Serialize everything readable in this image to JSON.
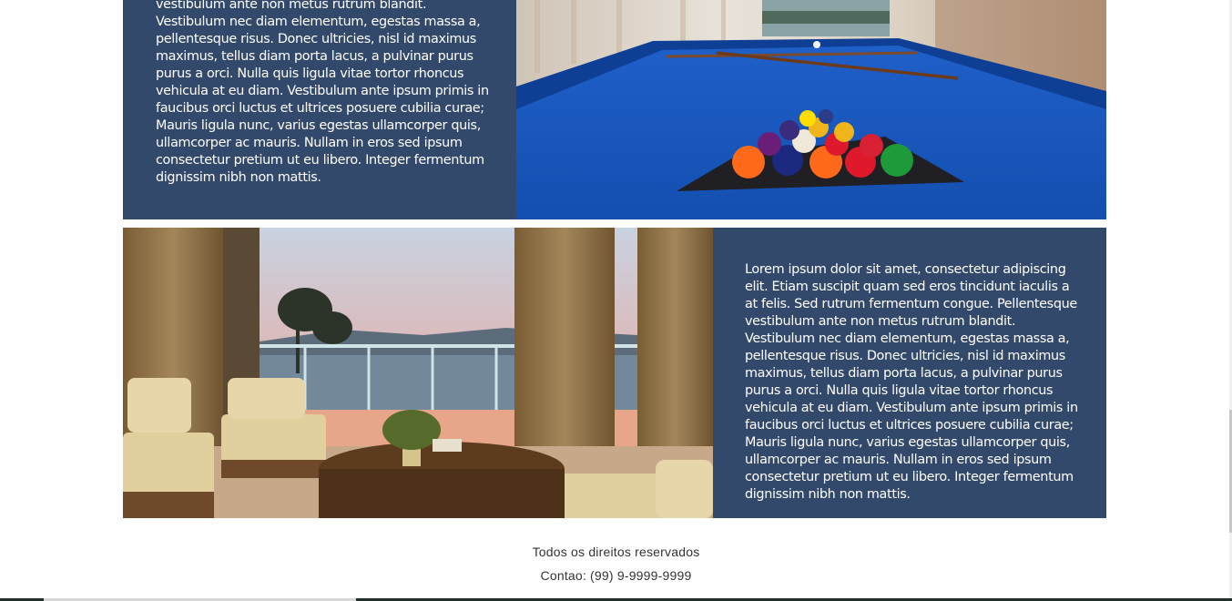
{
  "sections": [
    {
      "text": "Sed rutrum fermentum congue. Pellentesque vestibulum ante non metus rutrum blandit. Vestibulum nec diam elementum, egestas massa a, pellentesque risus. Donec ultricies, nisl id maximus maximus, tellus diam porta lacus, a pulvinar purus purus a orci. Nulla quis ligula vitae tortor rhoncus vehicula at eu diam. Vestibulum ante ipsum primis in faucibus orci luctus et ultrices posuere cubilia curae; Mauris ligula nunc, varius egestas ullamcorper quis, ullamcorper ac mauris. Nullam in eros sed ipsum consectetur pretium ut eu libero. Integer fermentum dignissim nibh non mattis."
    },
    {
      "text": "Lorem ipsum dolor sit amet, consectetur adipiscing elit. Etiam suscipit quam sed eros tincidunt iaculis a at felis. Sed rutrum fermentum congue. Pellentesque vestibulum ante non metus rutrum blandit. Vestibulum nec diam elementum, egestas massa a, pellentesque risus. Donec ultricies, nisl id maximus maximus, tellus diam porta lacus, a pulvinar purus purus a orci. Nulla quis ligula vitae tortor rhoncus vehicula at eu diam. Vestibulum ante ipsum primis in faucibus orci luctus et ultrices posuere cubilia curae; Mauris ligula nunc, varius egestas ullamcorper quis, ullamcorper ac mauris. Nullam in eros sed ipsum consectetur pretium ut eu libero. Integer fermentum dignissim nibh non mattis."
    }
  ],
  "footer": {
    "rights": "Todos os direitos reservados",
    "contact": "Contao: (99) 9-9999-9999"
  },
  "colors": {
    "panel": "#33496b",
    "text": "#ffffff"
  }
}
